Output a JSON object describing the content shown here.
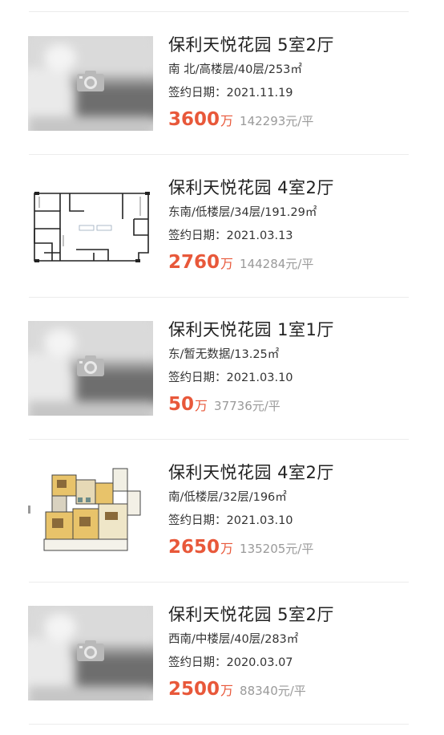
{
  "listings": [
    {
      "title": "保利天悦花园 5室2厅",
      "meta": "南 北/高楼层/40层/253㎡",
      "date_label": "签约日期：",
      "date": "2021.11.19",
      "price": "3600",
      "price_unit": "万",
      "unit_price": "142293元/平",
      "thumb": "photo-placeholder"
    },
    {
      "title": "保利天悦花园 4室2厅",
      "meta": "东南/低楼层/34层/191.29㎡",
      "date_label": "签约日期：",
      "date": "2021.03.13",
      "price": "2760",
      "price_unit": "万",
      "unit_price": "144284元/平",
      "thumb": "floor-plan"
    },
    {
      "title": "保利天悦花园 1室1厅",
      "meta": "东/暂无数据/13.25㎡",
      "date_label": "签约日期：",
      "date": "2021.03.10",
      "price": "50",
      "price_unit": "万",
      "unit_price": "37736元/平",
      "thumb": "photo-placeholder"
    },
    {
      "title": "保利天悦花园 4室2厅",
      "meta": "南/低楼层/32层/196㎡",
      "date_label": "签约日期：",
      "date": "2021.03.10",
      "price": "2650",
      "price_unit": "万",
      "unit_price": "135205元/平",
      "thumb": "color-floor-plan"
    },
    {
      "title": "保利天悦花园 5室2厅",
      "meta": "西南/中楼层/40层/283㎡",
      "date_label": "签约日期：",
      "date": "2020.03.07",
      "price": "2500",
      "price_unit": "万",
      "unit_price": "88340元/平",
      "thumb": "photo-placeholder"
    }
  ],
  "colors": {
    "price": "#e8583a",
    "title": "#222222",
    "secondary": "#9a9a9a",
    "divider": "#ececec"
  }
}
